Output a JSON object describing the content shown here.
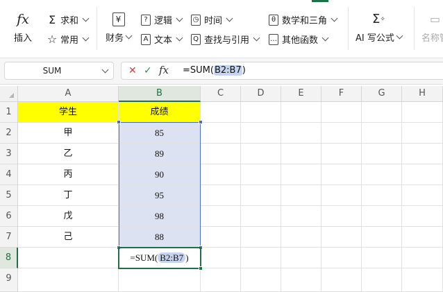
{
  "ribbon": {
    "insert_function": "插入",
    "autosum": "求和",
    "common": "常用",
    "finance": "财务",
    "logic": "逻辑",
    "text": "文本",
    "time": "时间",
    "lookup": "查找与引用",
    "math": "数学和三角",
    "other": "其他函数",
    "ai": "AI 写公式",
    "name_manager": "名称管"
  },
  "formula_bar": {
    "name_box": "SUM",
    "formula_prefix": "=SUM(",
    "formula_range": "B2:B7",
    "formula_suffix": ")"
  },
  "columns": [
    "A",
    "B",
    "C",
    "D",
    "E",
    "F",
    "G",
    "H"
  ],
  "rows": [
    "1",
    "2",
    "3",
    "4",
    "5",
    "6",
    "7",
    "8",
    "9"
  ],
  "table": {
    "header_a": "学生",
    "header_b": "成绩",
    "students": [
      "甲",
      "乙",
      "丙",
      "丁",
      "戊",
      "己"
    ],
    "scores": [
      "85",
      "89",
      "90",
      "95",
      "98",
      "88"
    ]
  },
  "editing_cell": {
    "prefix": "=SUM(",
    "range": "B2:B7",
    "suffix": ")"
  },
  "colors": {
    "header_fill": "#ffff00",
    "range_fill": "#dde2f3",
    "range_border": "#4a6fc1",
    "active_border": "#1e7145"
  }
}
